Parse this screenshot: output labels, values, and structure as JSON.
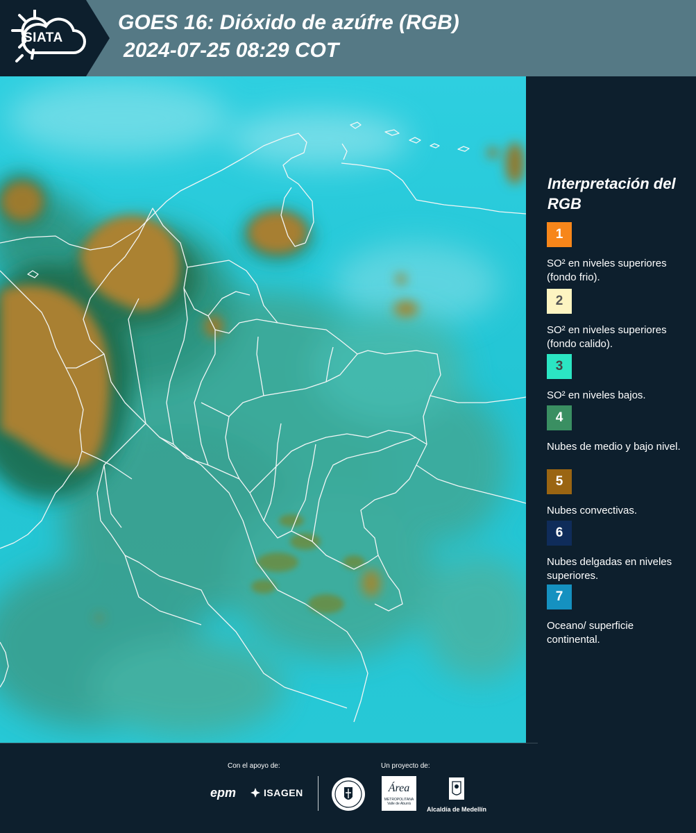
{
  "header": {
    "logo_text": "SIATA",
    "title_line1": "GOES 16: Dióxido de azúfre (RGB)",
    "title_line2": "2024-07-25 08:29 COT"
  },
  "legend": {
    "title": "Interpretación del RGB",
    "items": [
      {
        "number": "1",
        "color": "#f7861a",
        "text_color": "#ffffff",
        "description": "SO² en niveles superiores (fondo frio)."
      },
      {
        "number": "2",
        "color": "#fdf4c1",
        "text_color": "#555555",
        "description": "SO² en niveles superiores (fondo calido)."
      },
      {
        "number": "3",
        "color": "#2be5c3",
        "text_color": "#444444",
        "description": "SO² en niveles bajos."
      },
      {
        "number": "4",
        "color": "#3a8f62",
        "text_color": "#ffffff",
        "description": "Nubes de medio y bajo nivel."
      },
      {
        "number": "5",
        "color": "#9a6512",
        "text_color": "#ffffff",
        "description": "Nubes convectivas."
      },
      {
        "number": "6",
        "color": "#0f2c5a",
        "text_color": "#ffffff",
        "description": "Nubes delgadas en niveles superiores."
      },
      {
        "number": "7",
        "color": "#1591c0",
        "text_color": "#ffffff",
        "description": "Oceano/ superficie continental."
      }
    ]
  },
  "footer": {
    "support_label": "Con el apoyo de:",
    "project_label": "Un proyecto de:",
    "epm_logo": "epm",
    "isagen_logo": "ISAGEN",
    "area_logo": "Área",
    "area_sub": "METROPOLITANA",
    "area_sub2": "Valle de Aburrá",
    "alcaldia_logo": "Alcaldía de Medellín"
  },
  "colors": {
    "background": "#0d1f2d",
    "header_band": "#557985",
    "ocean_cyan": "#1fc7d4",
    "land_green": "#3c9e8c",
    "convective_brown": "#a97e2c"
  }
}
